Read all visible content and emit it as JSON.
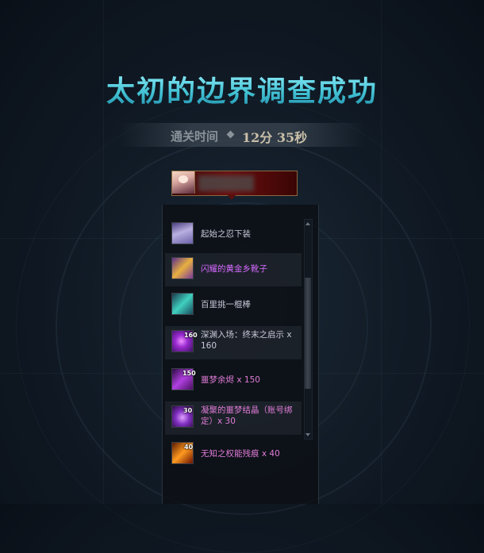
{
  "result": {
    "title": "太初的边界调查成功",
    "clear_time_label": "通关时间",
    "clear_time_value": "12分 35秒"
  },
  "player": {
    "avatar_icon": "character-portrait-icon"
  },
  "rewards": [
    {
      "name": "起始之忍下装",
      "icon": "pants-icon",
      "badge": "",
      "color": "#c8c8d8"
    },
    {
      "name": "闪耀的黄金乡靴子",
      "icon": "boots-icon",
      "badge": "",
      "color": "#d56aff"
    },
    {
      "name": "百里挑一棍棒",
      "icon": "staff-icon",
      "badge": "",
      "color": "#c8c8d8"
    },
    {
      "name": "深渊入场：终末之启示 x 160",
      "icon": "abyss-ticket-icon",
      "badge": "160",
      "color": "#c8c8d8"
    },
    {
      "name": "噩梦余烬 x 150",
      "icon": "ember-icon",
      "badge": "150",
      "color": "#e07cd8"
    },
    {
      "name": "凝聚的噩梦结晶（账号绑定）x 30",
      "icon": "crystal-icon",
      "badge": "30",
      "color": "#e07cd8"
    },
    {
      "name": "无知之权能残痕 x 40",
      "icon": "trace-icon",
      "badge": "40",
      "color": "#e07cd8"
    }
  ]
}
